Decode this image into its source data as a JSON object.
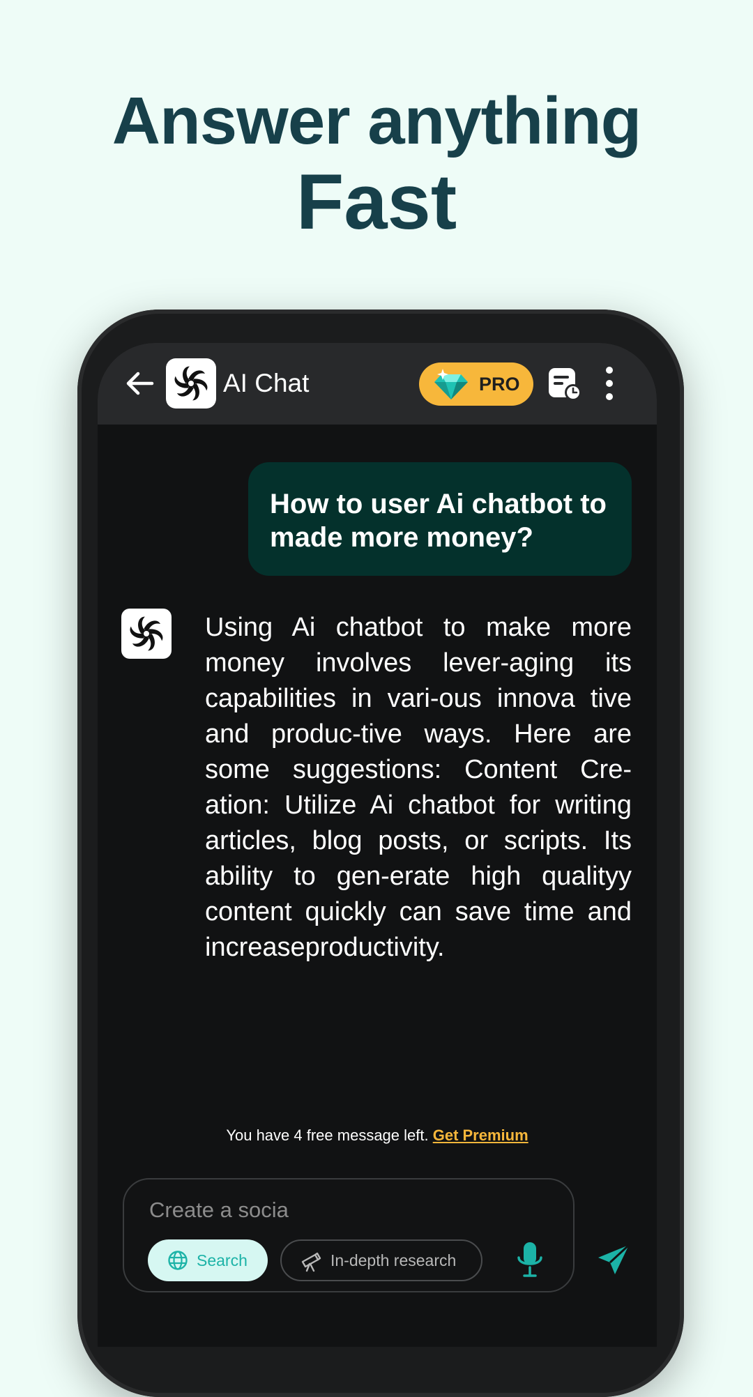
{
  "headline": {
    "line1": "Answer anything",
    "line2": "Fast"
  },
  "header": {
    "title": "AI Chat",
    "pro_label": "PRO"
  },
  "conversation": {
    "user_message": "How to user Ai chatbot to made more money?",
    "bot_message": "Using Ai chatbot to make more money involves lever-aging its capabilities in vari-ous innova tive and produc-tive ways. Here are some suggestions: Content Cre-ation: Utilize Ai chatbot for writing articles, blog posts, or scripts. Its ability to gen-erate high qualityy content quickly can save time and increaseproductivity."
  },
  "limit_notice": {
    "text": "You have 4 free message left.",
    "link": "Get Premium"
  },
  "composer": {
    "placeholder": "Create a socia",
    "chips": {
      "search": "Search",
      "research": "In-depth research"
    }
  },
  "colors": {
    "background": "#eefcf7",
    "headline": "#17404a",
    "accent_teal": "#1cb3a7",
    "pro_gold": "#f7b73b",
    "user_bubble": "#04312c"
  },
  "icons": [
    "back-arrow-icon",
    "app-logo-icon",
    "diamond-icon",
    "chat-history-icon",
    "more-vertical-icon",
    "globe-icon",
    "telescope-icon",
    "microphone-icon",
    "send-icon"
  ]
}
